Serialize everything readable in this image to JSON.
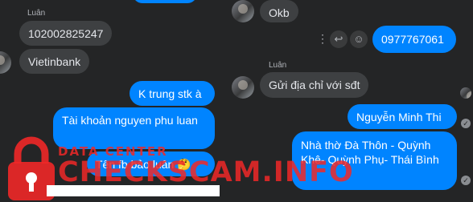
{
  "left": {
    "sender_name": "Luân",
    "messages_in": [
      "102002825247",
      "Vietinbank"
    ],
    "messages_out": [
      "K trung stk à",
      "Tài khoản nguyen phu luan",
      "Tên fb bảo luân 🤔"
    ]
  },
  "right": {
    "sender_name": "Luân",
    "messages_in": [
      "Okb",
      "Gửi địa chỉ với sđt"
    ],
    "messages_out": [
      "0977767061",
      "Nguyễn Minh Thi",
      "Nhà thờ Đà Thôn - Quỳnh Khê- Quỳnh Phụ- Thái Bình"
    ]
  },
  "watermark": {
    "line1": "DATA CENTER",
    "line2": "CHECKSCAM.INFO"
  },
  "icons": [
    "more-options-icon",
    "reply-icon",
    "emoji-icon",
    "read-check-icon",
    "padlock-logo"
  ],
  "colors": {
    "bg": "#242526",
    "incoming": "#3e4042",
    "outgoing": "#0084ff",
    "watermark": "#f02828"
  }
}
